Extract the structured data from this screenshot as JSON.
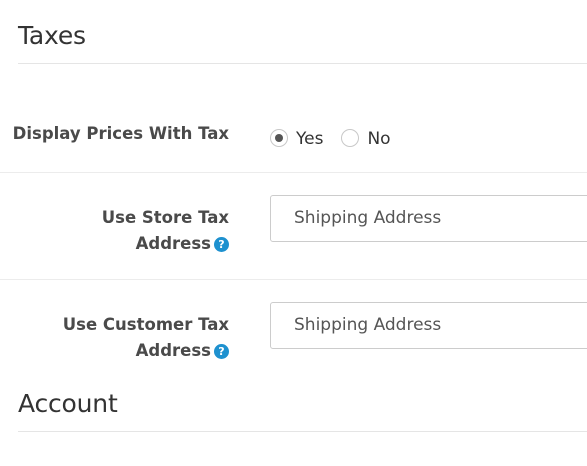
{
  "sections": {
    "taxes": {
      "title": "Taxes"
    },
    "account": {
      "title": "Account"
    }
  },
  "fields": {
    "display_prices_with_tax": {
      "label": "Display Prices With Tax",
      "options": [
        {
          "label": "Yes",
          "checked": true
        },
        {
          "label": "No",
          "checked": false
        }
      ]
    },
    "store_tax_address": {
      "label_line1": "Use Store Tax",
      "label_line2": "Address",
      "help_icon": "question-circle-icon",
      "value": "Shipping Address"
    },
    "customer_tax_address": {
      "label_line1": "Use Customer Tax",
      "label_line2": "Address",
      "help_icon": "question-circle-icon",
      "value": "Shipping Address"
    }
  },
  "colors": {
    "help_icon": "#1e91cf",
    "divider": "#e5e5e5"
  }
}
